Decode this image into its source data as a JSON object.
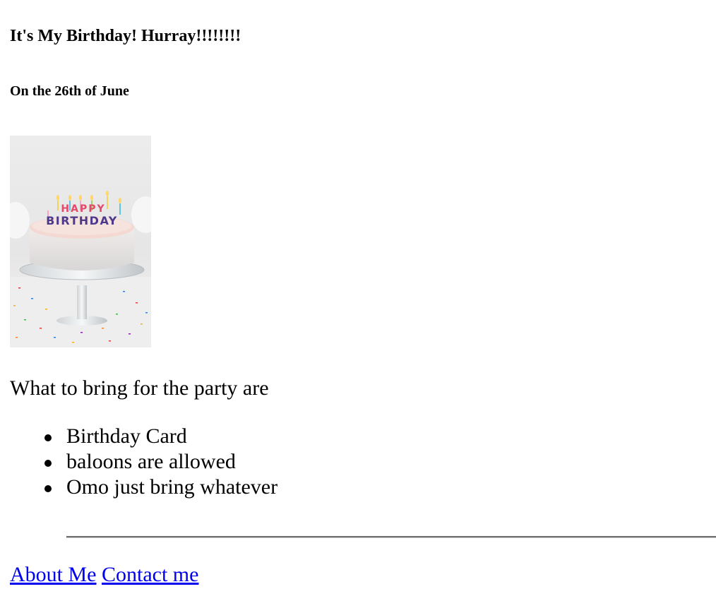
{
  "header": {
    "title": "It's My Birthday! Hurray!!!!!!!!",
    "subtitle": "On the 26th of June"
  },
  "image": {
    "alt": "birthday cake with HAPPY BIRTHDAY candles",
    "candle_text_top": "HAPPY",
    "candle_text_bottom": "BIRTHDAY"
  },
  "content": {
    "intro": "What to bring for the party are",
    "items": [
      {
        "label": "Birthday Card"
      },
      {
        "label": "baloons are allowed"
      },
      {
        "label": "Omo just bring whatever"
      }
    ]
  },
  "footer": {
    "links": [
      {
        "label": "About Me"
      },
      {
        "label": "Contact me"
      }
    ]
  },
  "colors": {
    "text": "#000000",
    "link": "#0000ee",
    "rule": "#6e6e6e"
  }
}
